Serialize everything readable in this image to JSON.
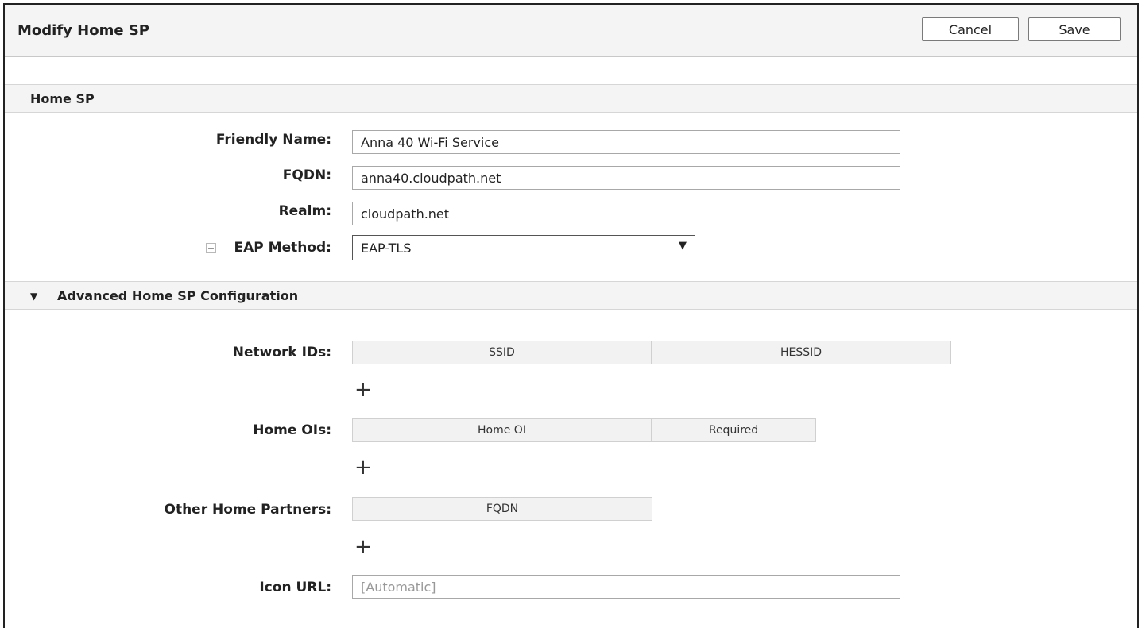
{
  "header": {
    "title": "Modify Home SP",
    "cancel_label": "Cancel",
    "save_label": "Save"
  },
  "home_sp": {
    "section_title": "Home SP",
    "friendly_name": {
      "label": "Friendly Name:",
      "value": "Anna 40 Wi-Fi Service"
    },
    "fqdn": {
      "label": "FQDN:",
      "value": "anna40.cloudpath.net"
    },
    "realm": {
      "label": "Realm:",
      "value": "cloudpath.net"
    },
    "eap_method": {
      "label": "EAP Method:",
      "selected": "EAP-TLS",
      "expand_glyph": "+",
      "arrow_glyph": "▼"
    }
  },
  "advanced": {
    "section_title": "Advanced Home SP Configuration",
    "caret_glyph": "▼",
    "network_ids": {
      "label": "Network IDs:",
      "columns": [
        "SSID",
        "HESSID"
      ]
    },
    "home_ois": {
      "label": "Home OIs:",
      "columns": [
        "Home OI",
        "Required"
      ]
    },
    "other_home_partners": {
      "label": "Other Home Partners:",
      "columns": [
        "FQDN"
      ]
    },
    "add_glyph": "+",
    "icon_url": {
      "label": "Icon URL:",
      "placeholder": "[Automatic]"
    }
  },
  "icons": {
    "expand": "plus-square-icon",
    "dropdown": "triangle-down-icon",
    "collapse": "caret-down-icon",
    "add": "plus-icon"
  },
  "colors": {
    "header_bg": "#f4f4f4",
    "table_header_bg": "#f2f2f2",
    "border": "#a8a8a8"
  }
}
